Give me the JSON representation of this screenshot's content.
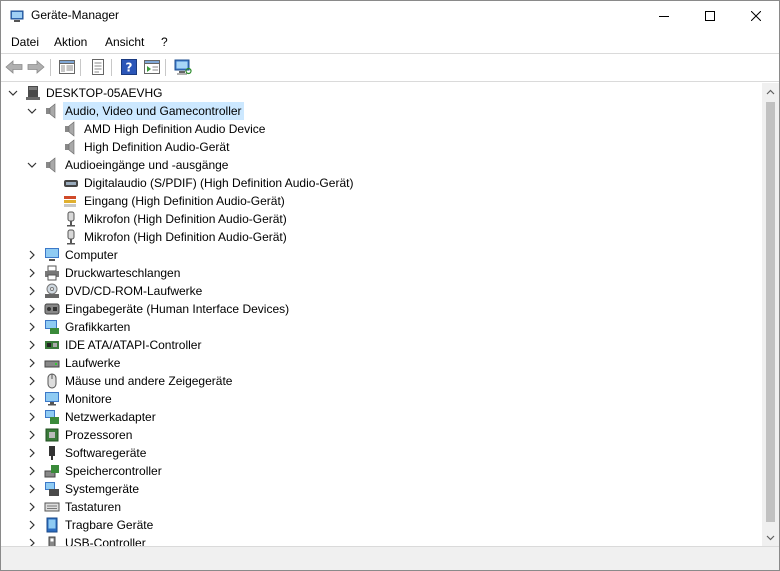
{
  "window": {
    "title": "Geräte-Manager"
  },
  "menu": {
    "items": [
      "Datei",
      "Aktion",
      "Ansicht",
      "?"
    ]
  },
  "toolbar": {
    "buttons": [
      "back-icon",
      "forward-icon",
      "properties-pane-icon",
      "update-driver-icon",
      "help-icon",
      "action-view-icon",
      "scan-hardware-icon"
    ]
  },
  "tree": {
    "root": "DESKTOP-05AEVHG",
    "categories": [
      {
        "label": "Audio, Video und Gamecontroller",
        "expanded": true,
        "selected": true,
        "children": [
          "AMD High Definition Audio Device",
          "High Definition Audio-Gerät"
        ]
      },
      {
        "label": "Audioeingänge und -ausgänge",
        "expanded": true,
        "children": [
          "Digitalaudio (S/PDIF) (High Definition Audio-Gerät)",
          "Eingang (High Definition Audio-Gerät)",
          "Mikrofon (High Definition Audio-Gerät)",
          "Mikrofon (High Definition Audio-Gerät)"
        ]
      },
      {
        "label": "Computer"
      },
      {
        "label": "Druckwarteschlangen"
      },
      {
        "label": "DVD/CD-ROM-Laufwerke"
      },
      {
        "label": "Eingabegeräte (Human Interface Devices)"
      },
      {
        "label": "Grafikkarten"
      },
      {
        "label": "IDE ATA/ATAPI-Controller"
      },
      {
        "label": "Laufwerke"
      },
      {
        "label": "Mäuse und andere Zeigegeräte"
      },
      {
        "label": "Monitore"
      },
      {
        "label": "Netzwerkadapter"
      },
      {
        "label": "Prozessoren"
      },
      {
        "label": "Softwaregeräte"
      },
      {
        "label": "Speichercontroller"
      },
      {
        "label": "Systemgeräte"
      },
      {
        "label": "Tastaturen"
      },
      {
        "label": "Tragbare Geräte"
      },
      {
        "label": "USB-Controller"
      }
    ]
  },
  "colors": {
    "selection": "#cce8ff",
    "window_border": "#8a8a8a",
    "scrollbar": "#f0f0f0"
  }
}
